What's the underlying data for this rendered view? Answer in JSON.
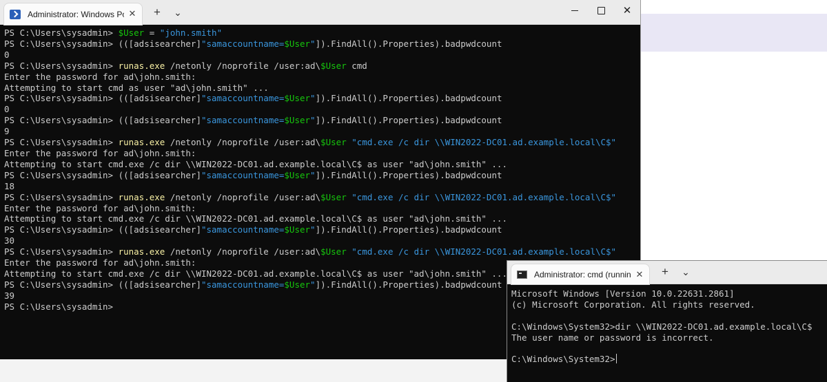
{
  "ps_window": {
    "tab_title": "Administrator: Windows PowerShell",
    "icon": "powershell-icon",
    "new_tab": "+",
    "dropdown": "⌄",
    "lines": [
      [
        [
          "w",
          "PS C:\\Users\\sysadmin> "
        ],
        [
          "g",
          "$User"
        ],
        [
          "w",
          " = "
        ],
        [
          "c",
          "\"john.smith\""
        ]
      ],
      [
        [
          "w",
          "PS C:\\Users\\sysadmin> (([adsisearcher]"
        ],
        [
          "c",
          "\"samaccountname="
        ],
        [
          "g",
          "$User"
        ],
        [
          "c",
          "\""
        ],
        [
          "w",
          "]).FindAll().Properties).badpwdcount"
        ]
      ],
      [
        [
          "w",
          "0"
        ]
      ],
      [
        [
          "w",
          "PS C:\\Users\\sysadmin> "
        ],
        [
          "y",
          "runas.exe"
        ],
        [
          "w",
          " /netonly /noprofile /user:ad\\"
        ],
        [
          "g",
          "$User"
        ],
        [
          "w",
          " cmd"
        ]
      ],
      [
        [
          "w",
          "Enter the password for ad\\john.smith:"
        ]
      ],
      [
        [
          "w",
          "Attempting to start cmd as user \"ad\\john.smith\" ..."
        ]
      ],
      [
        [
          "w",
          "PS C:\\Users\\sysadmin> (([adsisearcher]"
        ],
        [
          "c",
          "\"samaccountname="
        ],
        [
          "g",
          "$User"
        ],
        [
          "c",
          "\""
        ],
        [
          "w",
          "]).FindAll().Properties).badpwdcount"
        ]
      ],
      [
        [
          "w",
          "0"
        ]
      ],
      [
        [
          "w",
          "PS C:\\Users\\sysadmin> (([adsisearcher]"
        ],
        [
          "c",
          "\"samaccountname="
        ],
        [
          "g",
          "$User"
        ],
        [
          "c",
          "\""
        ],
        [
          "w",
          "]).FindAll().Properties).badpwdcount"
        ]
      ],
      [
        [
          "w",
          "9"
        ]
      ],
      [
        [
          "w",
          "PS C:\\Users\\sysadmin> "
        ],
        [
          "y",
          "runas.exe"
        ],
        [
          "w",
          " /netonly /noprofile /user:ad\\"
        ],
        [
          "g",
          "$User"
        ],
        [
          "w",
          " "
        ],
        [
          "c",
          "\"cmd.exe /c dir \\\\WIN2022-DC01.ad.example.local\\C$\""
        ]
      ],
      [
        [
          "w",
          "Enter the password for ad\\john.smith:"
        ]
      ],
      [
        [
          "w",
          "Attempting to start cmd.exe /c dir \\\\WIN2022-DC01.ad.example.local\\C$ as user \"ad\\john.smith\" ..."
        ]
      ],
      [
        [
          "w",
          "PS C:\\Users\\sysadmin> (([adsisearcher]"
        ],
        [
          "c",
          "\"samaccountname="
        ],
        [
          "g",
          "$User"
        ],
        [
          "c",
          "\""
        ],
        [
          "w",
          "]).FindAll().Properties).badpwdcount"
        ]
      ],
      [
        [
          "w",
          "18"
        ]
      ],
      [
        [
          "w",
          "PS C:\\Users\\sysadmin> "
        ],
        [
          "y",
          "runas.exe"
        ],
        [
          "w",
          " /netonly /noprofile /user:ad\\"
        ],
        [
          "g",
          "$User"
        ],
        [
          "w",
          " "
        ],
        [
          "c",
          "\"cmd.exe /c dir \\\\WIN2022-DC01.ad.example.local\\C$\""
        ]
      ],
      [
        [
          "w",
          "Enter the password for ad\\john.smith:"
        ]
      ],
      [
        [
          "w",
          "Attempting to start cmd.exe /c dir \\\\WIN2022-DC01.ad.example.local\\C$ as user \"ad\\john.smith\" ..."
        ]
      ],
      [
        [
          "w",
          "PS C:\\Users\\sysadmin> (([adsisearcher]"
        ],
        [
          "c",
          "\"samaccountname="
        ],
        [
          "g",
          "$User"
        ],
        [
          "c",
          "\""
        ],
        [
          "w",
          "]).FindAll().Properties).badpwdcount"
        ]
      ],
      [
        [
          "w",
          "30"
        ]
      ],
      [
        [
          "w",
          "PS C:\\Users\\sysadmin> "
        ],
        [
          "y",
          "runas.exe"
        ],
        [
          "w",
          " /netonly /noprofile /user:ad\\"
        ],
        [
          "g",
          "$User"
        ],
        [
          "w",
          " "
        ],
        [
          "c",
          "\"cmd.exe /c dir \\\\WIN2022-DC01.ad.example.local\\C$\""
        ]
      ],
      [
        [
          "w",
          "Enter the password for ad\\john.smith:"
        ]
      ],
      [
        [
          "w",
          "Attempting to start cmd.exe /c dir \\\\WIN2022-DC01.ad.example.local\\C$ as user \"ad\\john.smith\" ..."
        ]
      ],
      [
        [
          "w",
          "PS C:\\Users\\sysadmin> (([adsisearcher]"
        ],
        [
          "c",
          "\"samaccountname="
        ],
        [
          "g",
          "$User"
        ],
        [
          "c",
          "\""
        ],
        [
          "w",
          "]).FindAll().Properties).badpwdcount"
        ]
      ],
      [
        [
          "w",
          "39"
        ]
      ],
      [
        [
          "w",
          "PS C:\\Users\\sysadmin>"
        ]
      ]
    ]
  },
  "cmd_window": {
    "tab_title": "Administrator: cmd (running as ad\\john.smith)",
    "icon": "cmd-icon",
    "new_tab": "+",
    "dropdown": "⌄",
    "lines": [
      "Microsoft Windows [Version 10.0.22631.2861]",
      "(c) Microsoft Corporation. All rights reserved.",
      "",
      "C:\\Windows\\System32>dir \\\\WIN2022-DC01.ad.example.local\\C$",
      "The user name or password is incorrect.",
      "",
      "C:\\Windows\\System32>"
    ]
  },
  "colors": {
    "console_bg": "#0c0c0c",
    "text": "#cccccc",
    "variable": "#16c60c",
    "string": "#3a96dd",
    "command": "#f9f1a5"
  }
}
